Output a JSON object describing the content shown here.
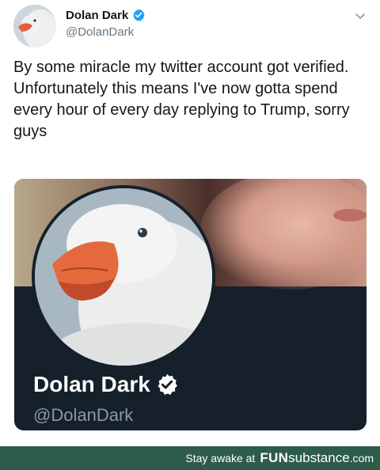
{
  "tweet": {
    "author_name": "Dolan Dark",
    "author_handle": "@DolanDark",
    "text": "By some miracle my twitter account got verified. Unfortunately this means I've now gotta spend every hour of every day replying to Trump, sorry guys"
  },
  "card": {
    "name": "Dolan Dark",
    "handle": "@DolanDark"
  },
  "footer": {
    "prefix": "Stay awake at",
    "brand_bold": "FUN",
    "brand_regular": "substance",
    "tld": ".com"
  },
  "colors": {
    "verified": "#1da1f2",
    "card_bg": "#15202b",
    "footer_bg": "#2e5c4a"
  },
  "icons": {
    "verified": "verified-badge-icon",
    "menu": "chevron-down-icon"
  }
}
